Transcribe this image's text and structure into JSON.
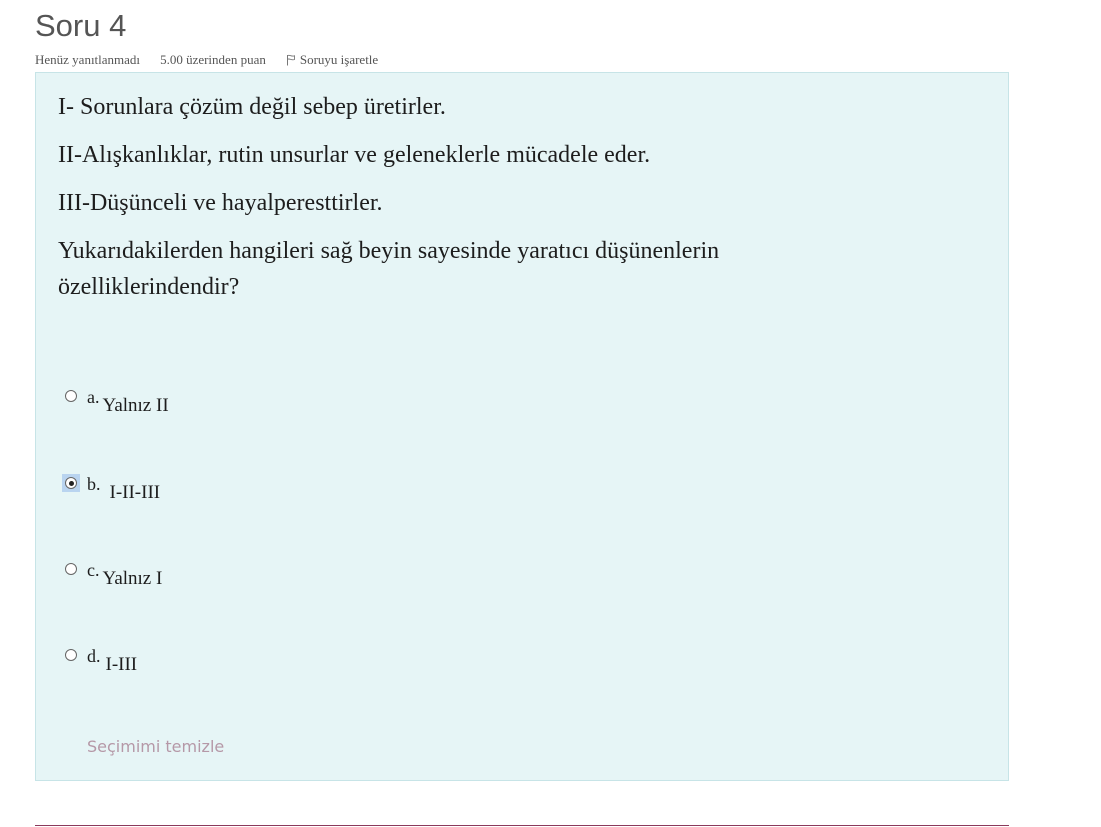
{
  "question": {
    "title": "Soru 4",
    "status": "Henüz yanıtlanmadı",
    "grade": "5.00 üzerinden puan",
    "flag_label": "Soruyu işaretle",
    "text": [
      "I- Sorunlara çözüm değil sebep üretirler.",
      "II-Alışkanlıklar, rutin unsurlar ve geleneklerle mücadele eder.",
      "III-Düşünceli ve hayalperesttirler.",
      "Yukarıdakilerden hangileri sağ beyin sayesinde yaratıcı düşünenlerin özelliklerindendir?"
    ],
    "options": [
      {
        "letter": "a.",
        "text": "Yalnız II",
        "selected": false
      },
      {
        "letter": "b.",
        "text": "I-II-III",
        "selected": true
      },
      {
        "letter": "c.",
        "text": "Yalnız I",
        "selected": false
      },
      {
        "letter": "d.",
        "text": "I-III",
        "selected": false
      }
    ],
    "clear_label": "Seçimimi temizle"
  },
  "colors": {
    "panel_bg": "#e6f5f6",
    "clear_link": "#b598a7",
    "bottom_rule": "#8b3a5c"
  }
}
